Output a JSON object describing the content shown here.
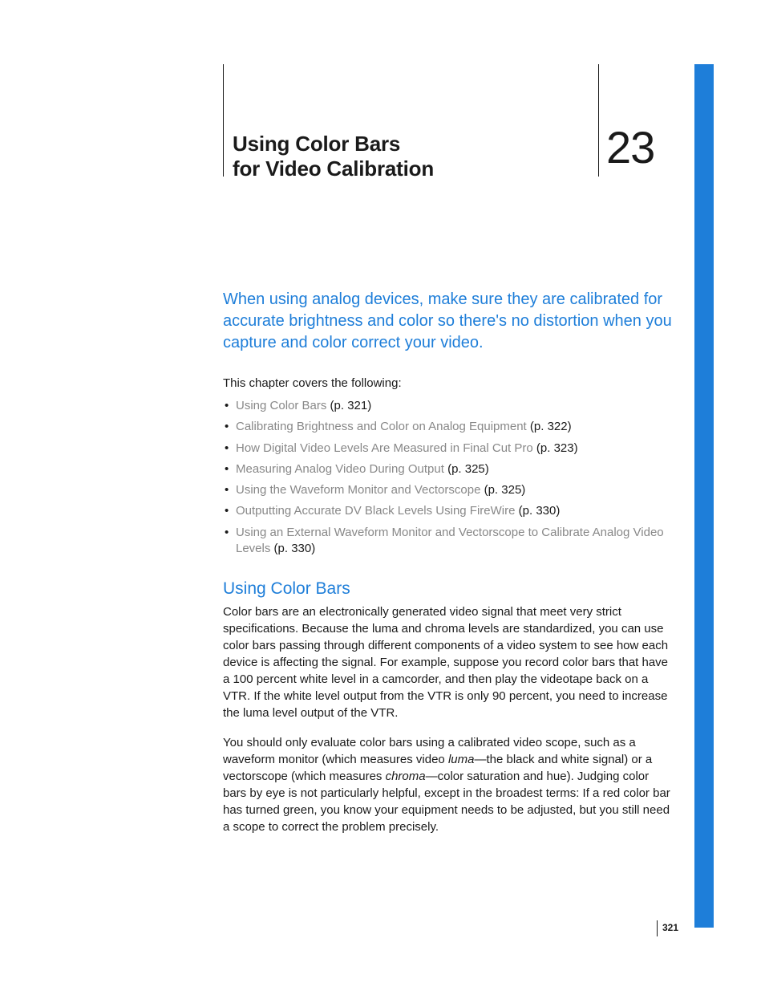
{
  "chapter": {
    "number": "23",
    "title_line1": "Using Color Bars",
    "title_line2": "for Video Calibration"
  },
  "intro": "When using analog devices, make sure they are calibrated for accurate brightness and color so there's no distortion when you capture and color correct your video.",
  "covers_label": "This chapter covers the following:",
  "toc": [
    {
      "title": "Using Color Bars",
      "page": "(p. 321)"
    },
    {
      "title": "Calibrating Brightness and Color on Analog Equipment",
      "page": "(p. 322)"
    },
    {
      "title": "How Digital Video Levels Are Measured in Final Cut Pro",
      "page": "(p. 323)"
    },
    {
      "title": "Measuring Analog Video During Output",
      "page": "(p. 325)"
    },
    {
      "title": "Using the Waveform Monitor and Vectorscope",
      "page": "(p. 325)"
    },
    {
      "title": "Outputting Accurate DV Black Levels Using FireWire",
      "page": "(p. 330)"
    },
    {
      "title": "Using an External Waveform Monitor and Vectorscope to Calibrate Analog Video Levels",
      "page": "(p. 330)"
    }
  ],
  "section": {
    "heading": "Using Color Bars",
    "p1": "Color bars are an electronically generated video signal that meet very strict specifications. Because the luma and chroma levels are standardized, you can use color bars passing through different components of a video system to see how each device is affecting the signal. For example, suppose you record color bars that have a 100 percent white level in a camcorder, and then play the videotape back on a VTR. If the white level output from the VTR is only 90 percent, you need to increase the luma level output of the VTR.",
    "p2_a": "You should only evaluate color bars using a calibrated video scope, such as a waveform monitor (which measures video ",
    "p2_luma": "luma",
    "p2_b": "—the black and white signal) or a vectorscope (which measures ",
    "p2_chroma": "chroma",
    "p2_c": "—color saturation and hue). Judging color bars by eye is not particularly helpful, except in the broadest terms:  If a red color bar has turned green, you know your equipment needs to be adjusted, but you still need a scope to correct the problem precisely."
  },
  "page_number": "321"
}
